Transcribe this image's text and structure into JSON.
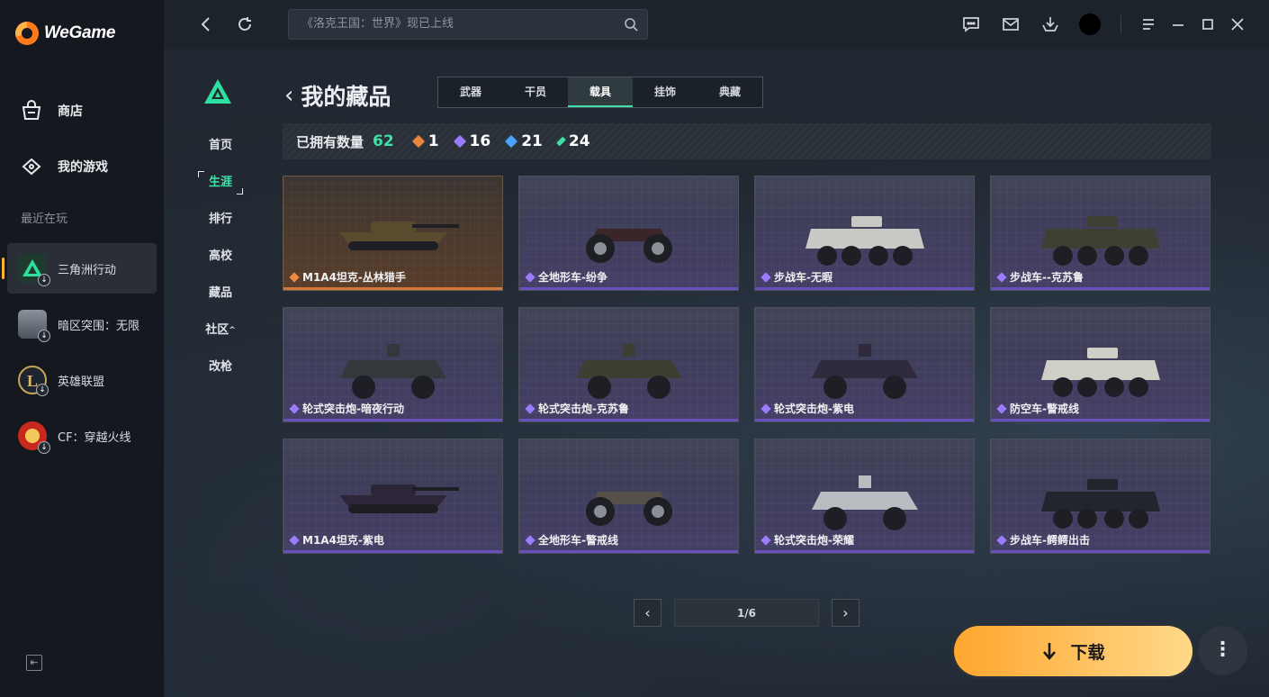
{
  "app": {
    "name": "WeGame"
  },
  "sidebar": {
    "nav": [
      {
        "label": "商店",
        "icon": "shop-bag-icon"
      },
      {
        "label": "我的游戏",
        "icon": "gamepad-icon"
      }
    ],
    "recent_label": "最近在玩",
    "recent_games": [
      {
        "label": "三角洲行动",
        "active": true
      },
      {
        "label": "暗区突围：无限",
        "active": false
      },
      {
        "label": "英雄联盟",
        "active": false
      },
      {
        "label": "CF：穿越火线",
        "active": false
      }
    ]
  },
  "topbar": {
    "search_placeholder": "《洛克王国：世界》现已上线"
  },
  "subnav": {
    "items": [
      "首页",
      "生涯",
      "排行",
      "高校",
      "藏品",
      "社区",
      "改枪"
    ],
    "active": "生涯"
  },
  "page": {
    "title": "我的藏品",
    "tabs": [
      "武器",
      "干员",
      "载具",
      "挂饰",
      "典藏"
    ],
    "active_tab": "载具",
    "owned_label": "已拥有数量",
    "owned_total": "62",
    "rarity_counts": [
      {
        "count": "1",
        "color": "#e9853c"
      },
      {
        "count": "16",
        "color": "#9b7cff"
      },
      {
        "count": "21",
        "color": "#4aa3ff"
      },
      {
        "count": "24",
        "color": "#3fe0a5"
      }
    ]
  },
  "items": [
    {
      "name": "M1A4坦克-丛林猎手",
      "rarity": "gold",
      "kind": "tank",
      "camo": "#5a4a2e"
    },
    {
      "name": "全地形车-纷争",
      "rarity": "purple",
      "kind": "atv",
      "camo": "#3a2628"
    },
    {
      "name": "步战车-无暇",
      "rarity": "purple",
      "kind": "apc",
      "camo": "#c8c8c4"
    },
    {
      "name": "步战车--克苏鲁",
      "rarity": "purple",
      "kind": "apc",
      "camo": "#3d4032"
    },
    {
      "name": "轮式突击炮-暗夜行动",
      "rarity": "purple",
      "kind": "armored",
      "camo": "#34373c"
    },
    {
      "name": "轮式突击炮-克苏鲁",
      "rarity": "purple",
      "kind": "armored",
      "camo": "#3d3f32"
    },
    {
      "name": "轮式突击炮-紫电",
      "rarity": "purple",
      "kind": "armored",
      "camo": "#2f2a3c"
    },
    {
      "name": "防空车-警戒线",
      "rarity": "purple",
      "kind": "apc",
      "camo": "#cfcfc8"
    },
    {
      "name": "M1A4坦克-紫电",
      "rarity": "purple",
      "kind": "tank",
      "camo": "#2d2638"
    },
    {
      "name": "全地形车-警戒线",
      "rarity": "purple",
      "kind": "atv",
      "camo": "#55504a"
    },
    {
      "name": "轮式突击炮-荣耀",
      "rarity": "purple",
      "kind": "armored",
      "camo": "#b9bcc0"
    },
    {
      "name": "步战车-鳄鳄出击",
      "rarity": "purple",
      "kind": "apc",
      "camo": "#22242e"
    }
  ],
  "pager": {
    "current": "1/6"
  },
  "actions": {
    "download_label": "下载",
    "more_label": "⋮"
  }
}
